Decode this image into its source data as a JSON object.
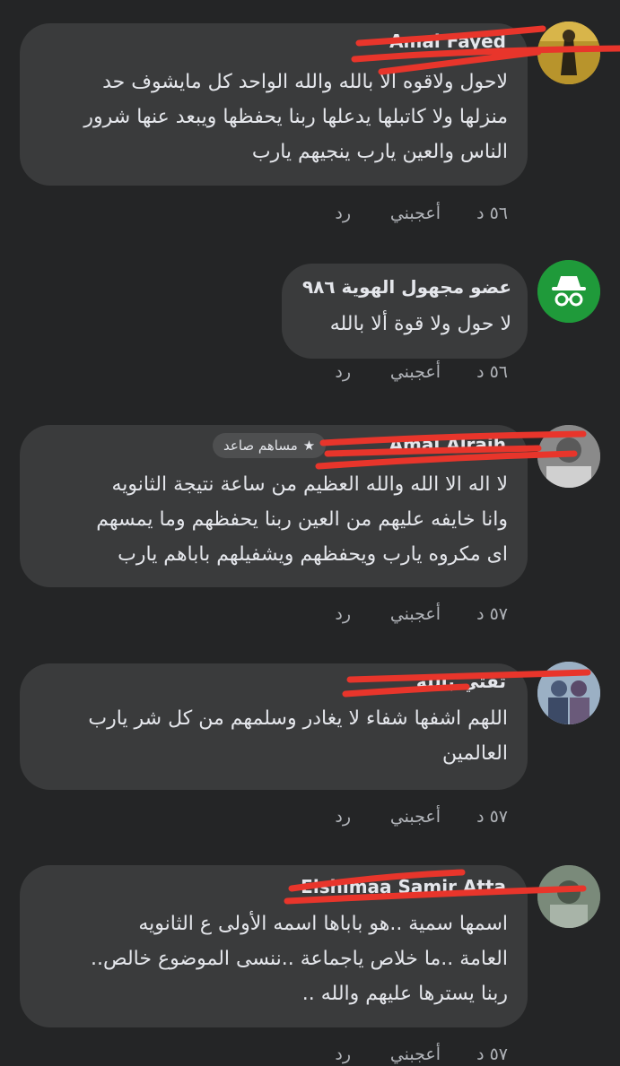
{
  "comments": [
    {
      "name": "Amal Fayed",
      "lines": [
        "لاحول ولاقوه الا بالله والله الواحد كل مايشوف حد",
        "منزلها ولا كاتبلها يدعلها ربنا يحفظها ويبعد عنها شرور",
        "الناس والعين يارب ينجيهم يارب"
      ],
      "time": "٥٦ د",
      "like": "أعجبني",
      "reply": "رد"
    },
    {
      "name": "عضو مجهول الهوية ٩٨٦",
      "lines": [
        "لا حول ولا قوة ألا بالله"
      ],
      "time": "٥٦ د",
      "like": "أعجبني",
      "reply": "رد"
    },
    {
      "name": "Amal Alraih",
      "badge": "مساهم صاعد",
      "lines": [
        "لا اله الا الله والله العظيم من ساعة نتيجة الثانويه",
        "وانا خايفه عليهم من العين ربنا يحفظهم وما يمسهم",
        "اى مكروه يارب ويحفظهم ويشفيلهم باباهم يارب"
      ],
      "time": "٥٧ د",
      "like": "أعجبني",
      "reply": "رد"
    },
    {
      "name": "ثقتي بالله",
      "lines": [
        "اللهم اشفها شفاء لا يغادر وسلمهم من كل شر يارب",
        "العالمين"
      ],
      "time": "٥٧ د",
      "like": "أعجبني",
      "reply": "رد"
    },
    {
      "name": "Elshimaa Samir Atta",
      "lines": [
        "اسمها سمية ..هو باباها اسمه الأولى ع الثانويه",
        "العامة ..ما خلاص ياجماعة ..ننسى الموضوع خالص..",
        "ربنا يسترها عليهم والله .."
      ],
      "time": "٥٧ د",
      "like": "أعجبني",
      "reply": "رد"
    }
  ],
  "colors": {
    "background": "#242526",
    "bubble": "#3a3b3c",
    "text": "#e4e6eb",
    "meta": "#b0b3b8",
    "strike": "#e8352b",
    "anon_avatar": "#1f9a3a"
  }
}
